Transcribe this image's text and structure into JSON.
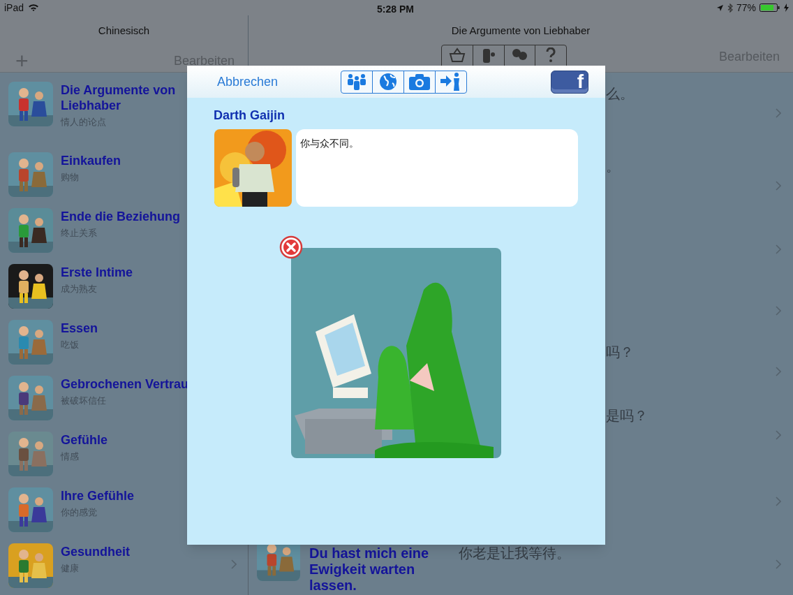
{
  "status_bar": {
    "carrier": "iPad",
    "time": "5:28 PM",
    "battery": "77%"
  },
  "sidebar": {
    "title": "Chinesisch",
    "add_button": "+",
    "edit_button": "Bearbeiten",
    "items": [
      {
        "title": "Die Argumente von Liebhaber",
        "subtitle": "情人的论点"
      },
      {
        "title": "Einkaufen",
        "subtitle": "购物"
      },
      {
        "title": "Ende die Beziehung",
        "subtitle": "终止关系"
      },
      {
        "title": "Erste Intime",
        "subtitle": "成为熟友"
      },
      {
        "title": "Essen",
        "subtitle": "吃饭"
      },
      {
        "title": "Gebrochenen Vertrau",
        "subtitle": "被破坏信任"
      },
      {
        "title": "Gefühle",
        "subtitle": "情感"
      },
      {
        "title": "Ihre Gefühle",
        "subtitle": "你的感觉"
      },
      {
        "title": "Gesundheit",
        "subtitle": "健康"
      }
    ]
  },
  "detail": {
    "title": "Die Argumente von Liebhaber",
    "edit_button": "Bearbeiten",
    "rows": [
      {
        "translation": "么。"
      },
      {
        "translation": "。"
      },
      {},
      {},
      {
        "translation": "吗？"
      },
      {
        "translation": "是吗？"
      },
      {},
      {
        "title": "Du hast mich eine Ewigkeit warten lassen.",
        "translation": "你老是让我等待。"
      }
    ]
  },
  "modal": {
    "cancel_button": "Abbrechen",
    "facebook_button": "f",
    "author": "Darth Gaijin",
    "message": "你与众不同。"
  }
}
